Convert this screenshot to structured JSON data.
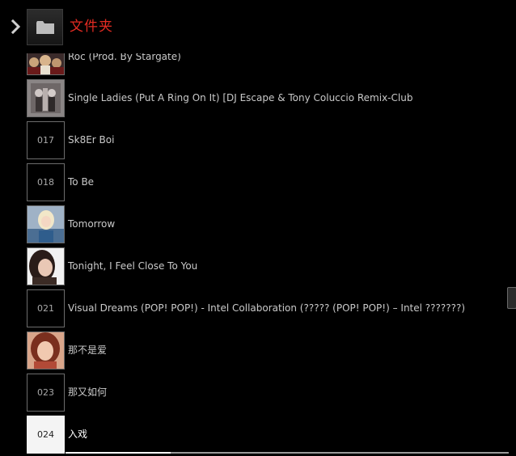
{
  "header": {
    "title": "文件夹",
    "folder_icon": "folder-icon",
    "back_icon": "chevron-right-icon",
    "title_color": "#e32b22"
  },
  "list": {
    "items": [
      {
        "num": "",
        "title": "Roc (Prod. By Stargate)",
        "art": "album-art"
      },
      {
        "num": "",
        "title": "Single Ladies (Put A Ring On It) [DJ Escape & Tony Coluccio Remix-Club",
        "art": "album-art"
      },
      {
        "num": "017",
        "title": "Sk8Er Boi",
        "art": ""
      },
      {
        "num": "018",
        "title": "To Be",
        "art": ""
      },
      {
        "num": "",
        "title": "Tomorrow",
        "art": "album-art"
      },
      {
        "num": "",
        "title": "Tonight, I Feel Close To You",
        "art": "album-art"
      },
      {
        "num": "021",
        "title": "Visual Dreams (POP! POP!) - Intel Collaboration (????? (POP! POP!) – Intel ???????)",
        "art": ""
      },
      {
        "num": "",
        "title": "那不是爱",
        "art": "album-art"
      },
      {
        "num": "023",
        "title": "那又如何",
        "art": ""
      },
      {
        "num": "024",
        "title": "入戏",
        "art": "",
        "active": true
      }
    ]
  }
}
